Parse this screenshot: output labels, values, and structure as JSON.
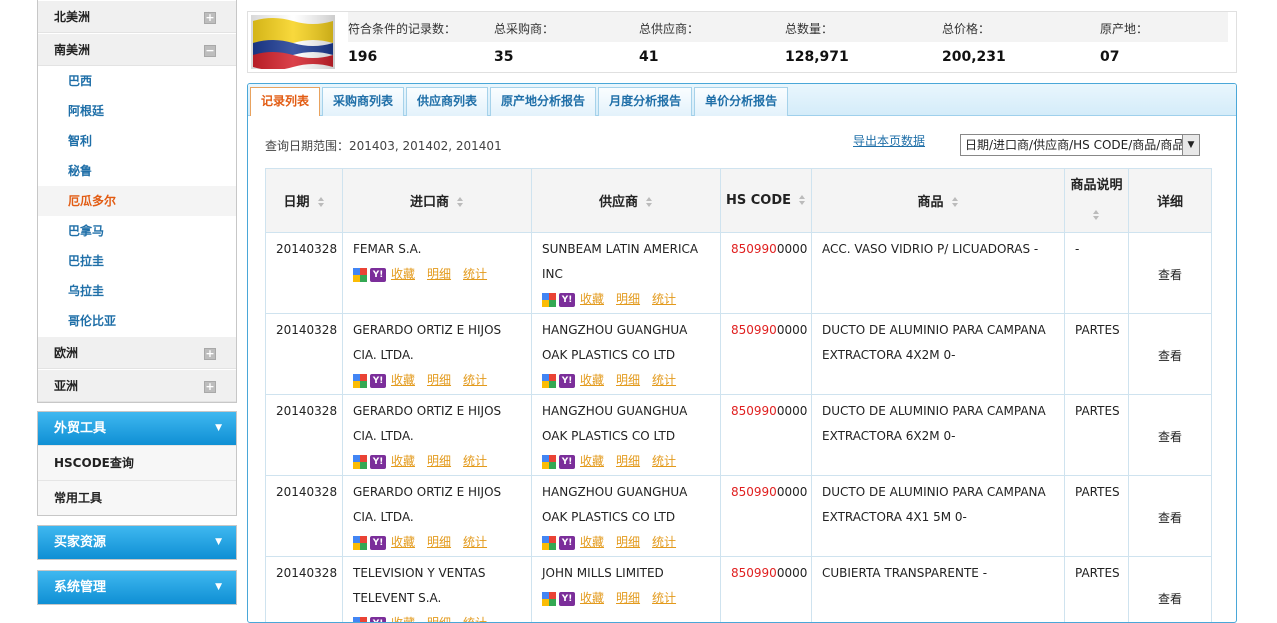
{
  "sidebar": {
    "regions": [
      {
        "name": "北美洲",
        "expanded": false,
        "countries": []
      },
      {
        "name": "南美洲",
        "expanded": true,
        "countries": [
          "巴西",
          "阿根廷",
          "智利",
          "秘鲁",
          "厄瓜多尔",
          "巴拿马",
          "巴拉圭",
          "乌拉圭",
          "哥伦比亚"
        ]
      },
      {
        "name": "欧洲",
        "expanded": false,
        "countries": []
      },
      {
        "name": "亚洲",
        "expanded": false,
        "countries": []
      }
    ],
    "active_country": "厄瓜多尔",
    "toggle_plus": "+",
    "toggle_minus": "−",
    "tools": {
      "title": "外贸工具",
      "items": [
        "HSCODE查询",
        "常用工具"
      ]
    },
    "buyers": {
      "title": "买家资源"
    },
    "system": {
      "title": "系统管理"
    }
  },
  "summary": {
    "labels": [
      "符合条件的记录数：",
      "总采购商：",
      "总供应商：",
      "总数量：",
      "总价格：",
      "原产地："
    ],
    "values": [
      "196",
      "35",
      "41",
      "128,971",
      "200,231",
      "07"
    ]
  },
  "tabs": [
    "记录列表",
    "采购商列表",
    "供应商列表",
    "原产地分析报告",
    "月度分析报告",
    "单价分析报告"
  ],
  "active_tab": "记录列表",
  "filter": {
    "range_label": "查询日期范围：",
    "range_value": "201403, 201402, 201401",
    "export_label": "导出本页数据",
    "sort_value": "日期/进口商/供应商/HS CODE/商品/商品说明"
  },
  "table": {
    "headers": [
      "日期",
      "进口商",
      "供应商",
      "HS CODE",
      "商品",
      "商品说明",
      "详细"
    ],
    "actions": [
      "收藏",
      "明细",
      "统计"
    ],
    "detail_label": "查看",
    "rows": [
      {
        "date": "20140328",
        "importer": "FEMAR S.A.",
        "supplier": "SUNBEAM LATIN AMERICA INC",
        "hs_red": "850990",
        "hs_rest": "0000",
        "product": "ACC. VASO VIDRIO P/ LICUADORAS -",
        "desc": "-"
      },
      {
        "date": "20140328",
        "importer": "GERARDO ORTIZ E HIJOS CIA. LTDA.",
        "supplier": "HANGZHOU GUANGHUA OAK PLASTICS CO LTD",
        "hs_red": "850990",
        "hs_rest": "0000",
        "product": "DUCTO DE ALUMINIO PARA CAMPANA EXTRACTORA 4X2M 0-",
        "desc": "PARTES"
      },
      {
        "date": "20140328",
        "importer": "GERARDO ORTIZ E HIJOS CIA. LTDA.",
        "supplier": "HANGZHOU GUANGHUA OAK PLASTICS CO LTD",
        "hs_red": "850990",
        "hs_rest": "0000",
        "product": "DUCTO DE ALUMINIO PARA CAMPANA EXTRACTORA 6X2M 0-",
        "desc": "PARTES"
      },
      {
        "date": "20140328",
        "importer": "GERARDO ORTIZ E HIJOS CIA. LTDA.",
        "supplier": "HANGZHOU GUANGHUA OAK PLASTICS CO LTD",
        "hs_red": "850990",
        "hs_rest": "0000",
        "product": "DUCTO DE ALUMINIO PARA CAMPANA EXTRACTORA 4X1 5M 0-",
        "desc": "PARTES"
      },
      {
        "date": "20140328",
        "importer": "TELEVISION Y VENTAS TELEVENT S.A.",
        "supplier": "JOHN MILLS LIMITED",
        "hs_red": "850990",
        "hs_rest": "0000",
        "product": "CUBIERTA TRANSPARENTE -",
        "desc": "PARTES"
      }
    ]
  },
  "colors": {
    "accent": "#1f6fa8",
    "active": "#e25c13",
    "hs_red": "#e02020",
    "action": "#e39a1c",
    "tab_border": "#4aa7d8"
  },
  "icons": [
    "plus-icon",
    "minus-icon",
    "chevron-down-icon",
    "google-icon",
    "yahoo-icon",
    "sort-icon",
    "flag-icon"
  ]
}
